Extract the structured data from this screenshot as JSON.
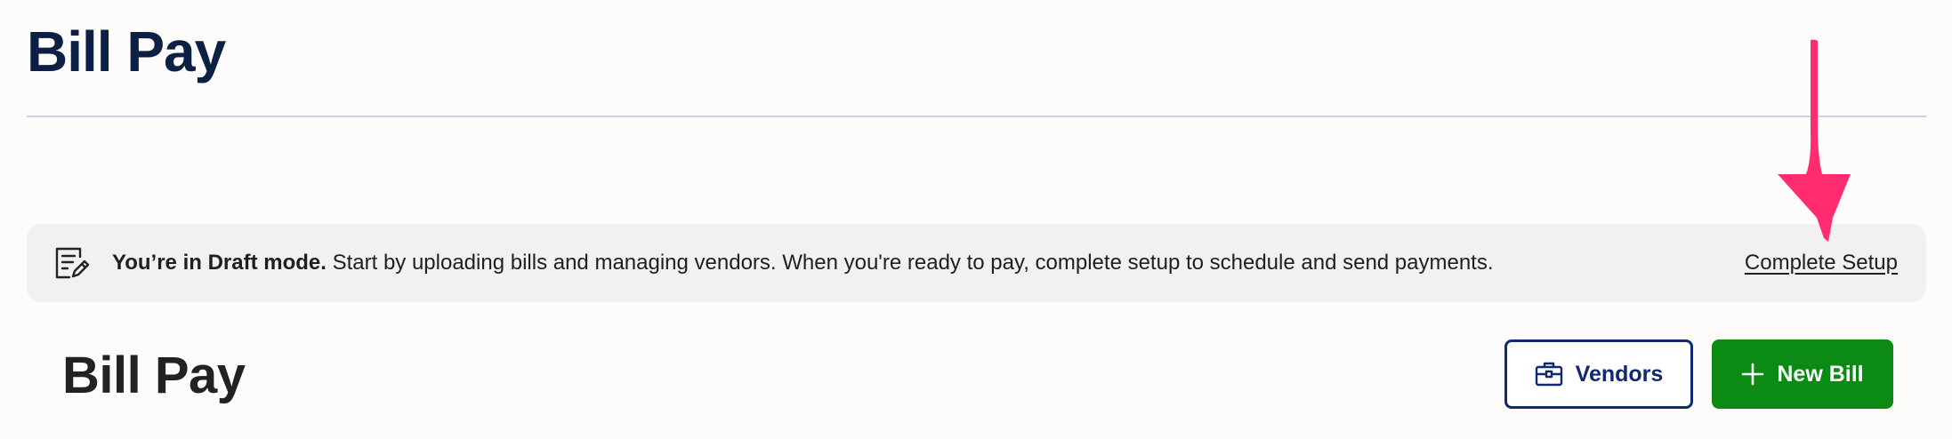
{
  "header": {
    "title": "Bill Pay"
  },
  "banner": {
    "icon": "edit-document-icon",
    "bold_text": "You’re in Draft mode.",
    "text": " Start by uploading bills and managing vendors. When you're ready to pay, complete setup to schedule and send payments.",
    "link_label": "Complete Setup"
  },
  "main": {
    "title": "Bill Pay",
    "vendors_button": {
      "label": "Vendors",
      "icon": "briefcase-icon"
    },
    "new_bill_button": {
      "label": "New Bill",
      "icon": "plus-icon"
    }
  },
  "annotation": {
    "type": "arrow",
    "color": "#ff2d6f"
  },
  "colors": {
    "brand_navy": "#0c1f45",
    "button_navy": "#102a70",
    "primary_green": "#0b8a14",
    "banner_bg": "#f1f1f2"
  }
}
